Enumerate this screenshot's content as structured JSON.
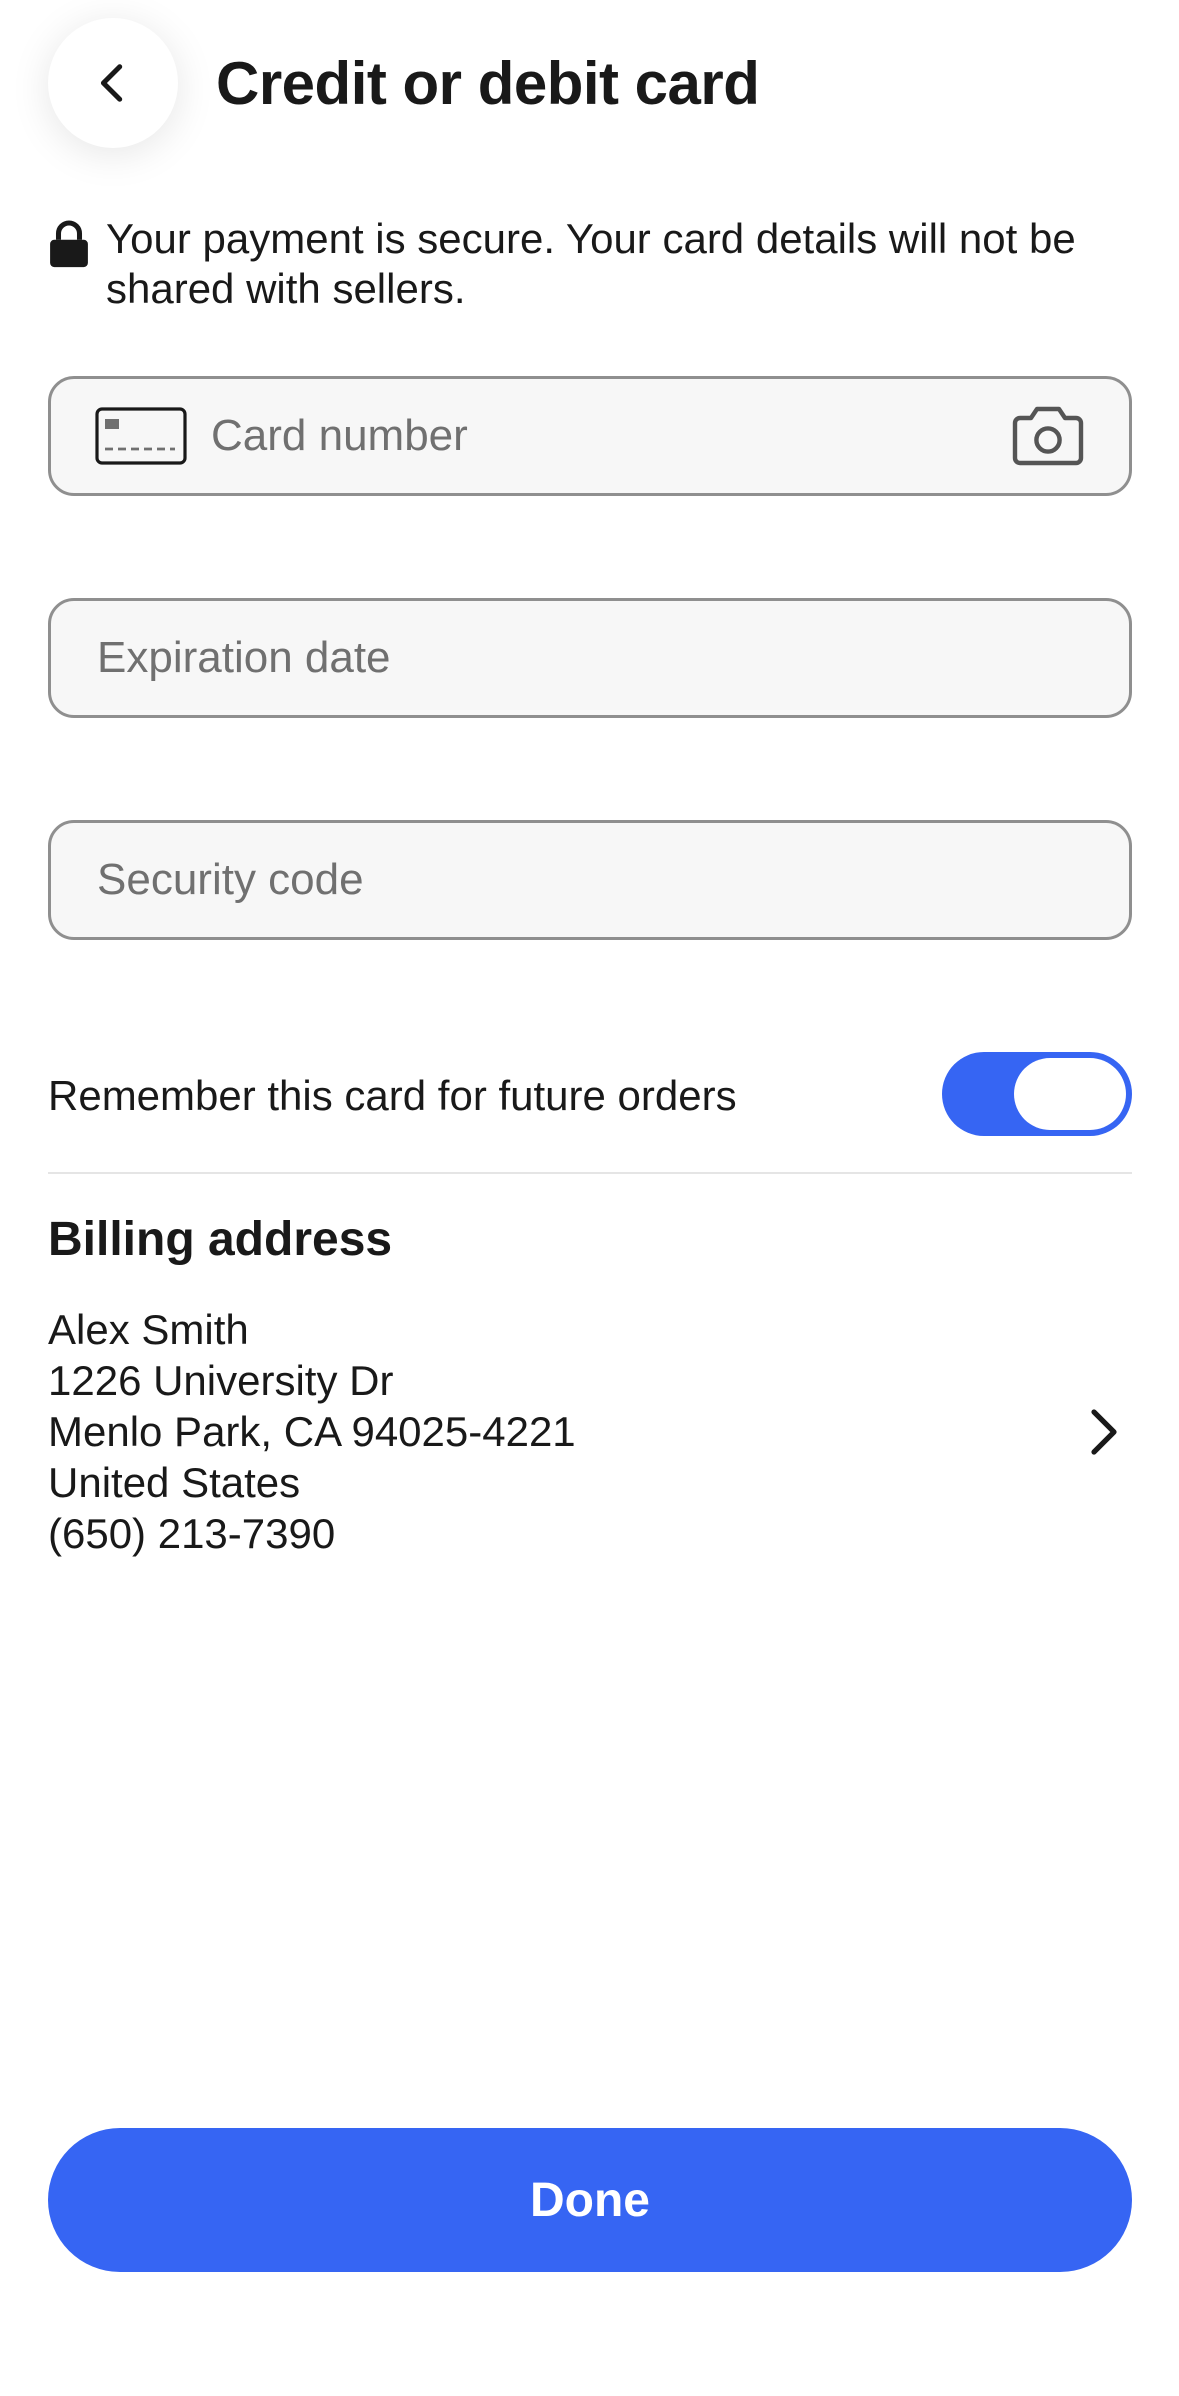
{
  "header": {
    "title": "Credit or debit card",
    "back_icon": "chevron-left-icon"
  },
  "secure_note": {
    "icon": "lock-icon",
    "text": "Your payment is secure. Your card details will not be shared with sellers."
  },
  "form": {
    "card_number": {
      "value": "",
      "placeholder": "Card number",
      "leading_icon": "card-icon",
      "trailing_icon": "camera-icon"
    },
    "expiration_date": {
      "value": "",
      "placeholder": "Expiration date"
    },
    "security_code": {
      "value": "",
      "placeholder": "Security code"
    }
  },
  "remember": {
    "label": "Remember this card for future orders",
    "enabled": true
  },
  "billing": {
    "title": "Billing address",
    "name": "Alex Smith",
    "street": "1226 University Dr",
    "city_line": "Menlo Park, CA 94025-4221",
    "country": "United States",
    "phone": "(650) 213-7390"
  },
  "actions": {
    "done_label": "Done"
  },
  "colors": {
    "accent": "#3665f3",
    "field_border": "#8f8f8f",
    "field_background": "#f7f7f7",
    "text": "#191919",
    "placeholder": "#707070"
  }
}
